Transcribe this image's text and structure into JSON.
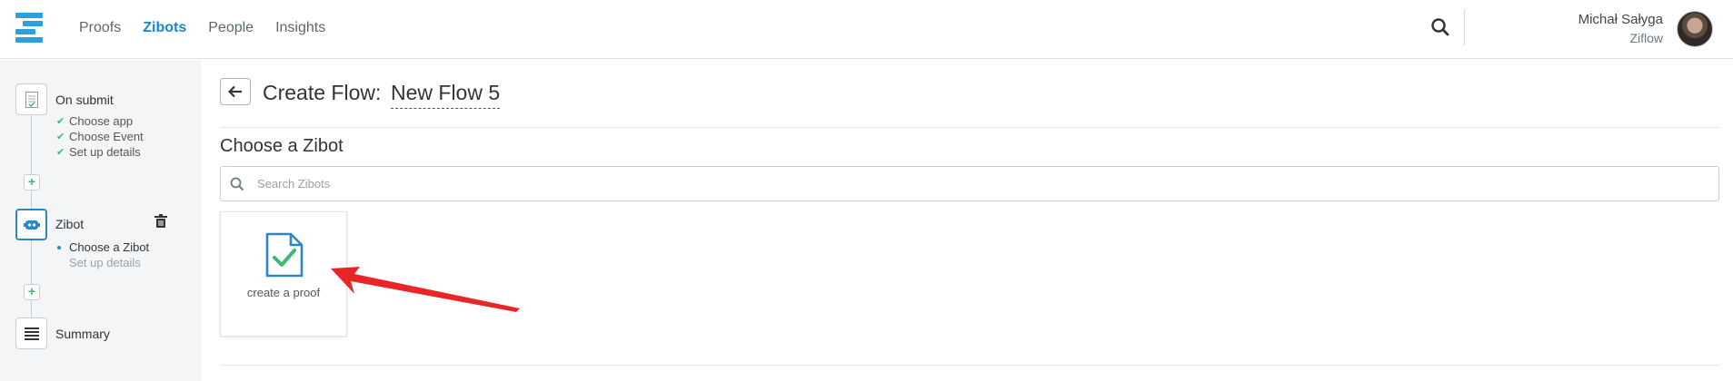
{
  "nav": {
    "items": [
      "Proofs",
      "Zibots",
      "People",
      "Insights"
    ],
    "active": "Zibots"
  },
  "user": {
    "name": "Michał Sałyga",
    "org": "Ziflow"
  },
  "sidebar": {
    "steps": [
      {
        "title": "On submit",
        "icon": "document-icon",
        "subs": [
          "Choose app",
          "Choose Event",
          "Set up details"
        ]
      },
      {
        "title": "Zibot",
        "icon": "robot-icon",
        "subs": [
          "Choose a Zibot",
          "Set up details"
        ]
      },
      {
        "title": "Summary",
        "icon": "list-icon"
      }
    ]
  },
  "main": {
    "title_prefix": "Create Flow:",
    "flow_name": "New Flow 5",
    "section_title": "Choose a Zibot",
    "search_placeholder": "Search Zibots",
    "cards": [
      {
        "label": "create a proof",
        "icon": "proof-document-icon"
      }
    ]
  },
  "colors": {
    "accent": "#1a86c8",
    "check": "#3cb878",
    "annotation_arrow": "#e8262a",
    "sidebar_bg": "#f3f5f7"
  }
}
